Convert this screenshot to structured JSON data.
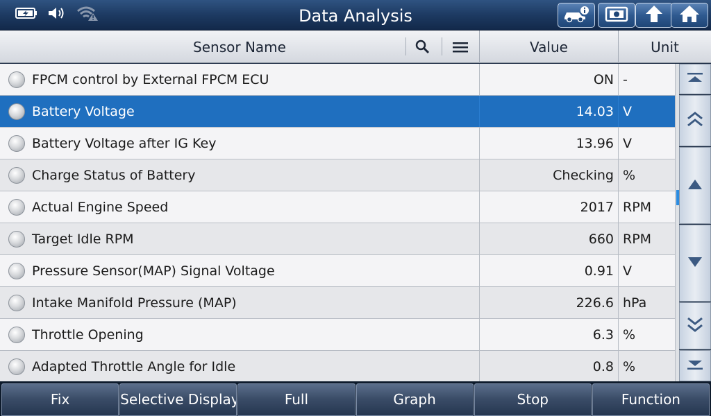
{
  "app": {
    "title": "Data Analysis"
  },
  "status": {
    "icons": [
      "battery-charging-icon",
      "speaker-icon",
      "wifi-warning-icon"
    ]
  },
  "toolbar": {
    "buttons": [
      "vehicle-info-icon",
      "screenshot-icon",
      "back-icon",
      "home-icon"
    ]
  },
  "table": {
    "columns": {
      "name": "Sensor Name",
      "value": "Value",
      "unit": "Unit"
    },
    "rows": [
      {
        "name": "FPCM control by External FPCM ECU",
        "value": "ON",
        "unit": "-"
      },
      {
        "name": "Battery Voltage",
        "value": "14.03",
        "unit": "V",
        "selected": true
      },
      {
        "name": "Battery Voltage after IG Key",
        "value": "13.96",
        "unit": "V"
      },
      {
        "name": "Charge Status of Battery",
        "value": "Checking",
        "unit": "%"
      },
      {
        "name": "Actual Engine Speed",
        "value": "2017",
        "unit": "RPM"
      },
      {
        "name": "Target Idle RPM",
        "value": "660",
        "unit": "RPM"
      },
      {
        "name": "Pressure Sensor(MAP) Signal Voltage",
        "value": "0.91",
        "unit": "V"
      },
      {
        "name": "Intake Manifold Pressure (MAP)",
        "value": "226.6",
        "unit": "hPa"
      },
      {
        "name": "Throttle Opening",
        "value": "6.3",
        "unit": "%"
      },
      {
        "name": "Adapted Throttle Angle for Idle",
        "value": "0.8",
        "unit": "%"
      }
    ]
  },
  "bottom": {
    "fix": "Fix",
    "selective": "Selective Display",
    "full": "Full",
    "graph": "Graph",
    "stop": "Stop",
    "function": "Function"
  },
  "colors": {
    "selected_row": "#1f6fbf",
    "title_bar": "#1d3a62"
  }
}
